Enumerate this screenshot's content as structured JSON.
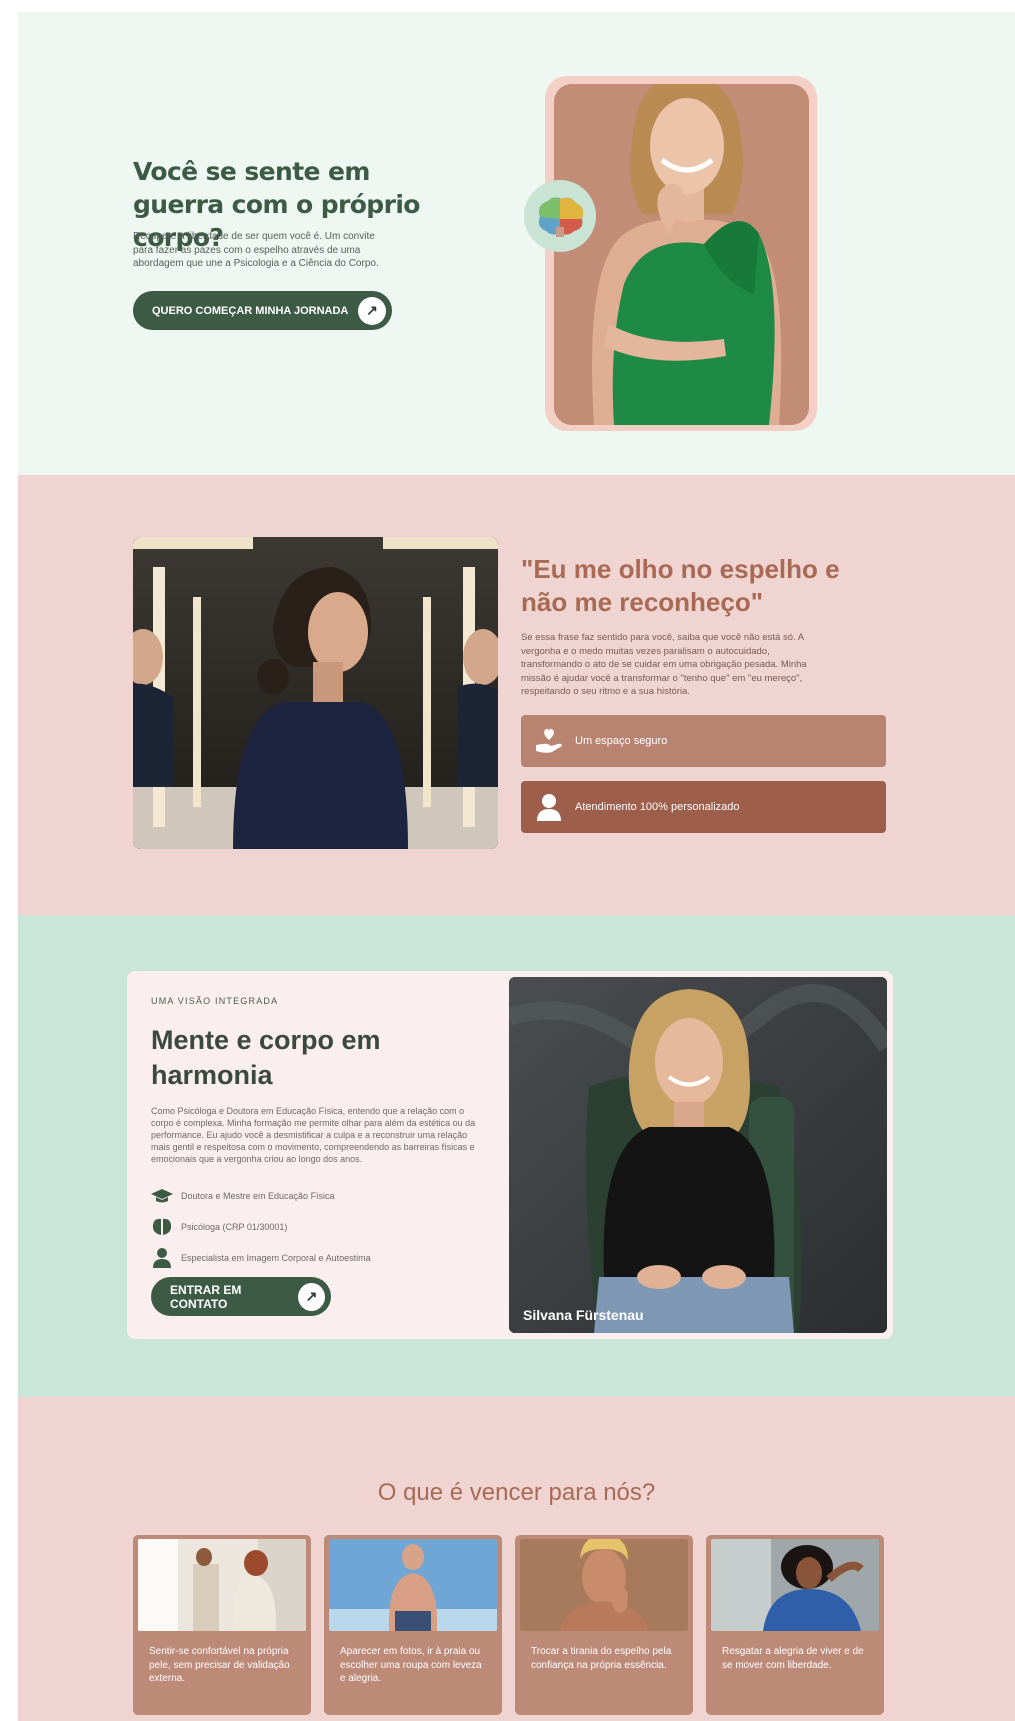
{
  "hero": {
    "title": "Você se sente em guerra com o próprio corpo?",
    "text": "Recupere a liberdade de ser quem você é. Um convite para fazer as pazes com o espelho através de uma abordagem que une a Psicologia e a Ciência do Corpo.",
    "cta_label": "QUERO COMEÇAR MINHA JORNADA",
    "cta_icon": "arrow-up-right-icon"
  },
  "mirror": {
    "quote": "\"Eu me olho no espelho e não me reconheço\"",
    "text": "Se essa frase faz sentido para você, saiba que você não está só. A vergonha e o medo muitas vezes paralisam o autocuidado, transformando o ato de se cuidar em uma obrigação pesada. Minha missão é ajudar você a transformar o \"tenho que\" em \"eu mereço\", respeitando o seu ritmo e a sua história.",
    "features": [
      {
        "label": "Um espaço seguro",
        "icon": "heart-hand-icon"
      },
      {
        "label": "Atendimento 100% personalizado",
        "icon": "user-icon"
      }
    ]
  },
  "integrated": {
    "eyebrow": "UMA VISÃO INTEGRADA",
    "title": "Mente e corpo em harmonia",
    "text": "Como Psicóloga e Doutora em Educação Física, entendo que a relação com o corpo é complexa. Minha formação me permite olhar para além da estética ou da performance. Eu ajudo você a desmistificar a culpa e a reconstruir uma relação mais gentil e respeitosa com o movimento, compreendendo as barreiras físicas e emocionais que a vergonha criou ao longo dos anos.",
    "credentials": [
      {
        "label": "Doutora e Mestre em Educação Física",
        "icon": "graduation-cap-icon"
      },
      {
        "label": "Psicóloga (CRP 01/30001)",
        "icon": "brain-icon"
      },
      {
        "label": "Especialista em Imagem Corporal e Autoestima",
        "icon": "user-icon"
      }
    ],
    "cta_label": "ENTRAR EM CONTATO",
    "photo_name": "Silvana Fürstenau"
  },
  "victory": {
    "title": "O que é vencer para nós?",
    "cards": [
      {
        "text": "Sentir-se confortável na própria pele, sem precisar de validação externa."
      },
      {
        "text": "Aparecer em fotos, ir à praia ou escolher uma roupa com leveza e alegria."
      },
      {
        "text": "Trocar a tirania do espelho pela confiança na própria essência."
      },
      {
        "text": "Resgatar a alegria de viver e de se mover com liberdade."
      }
    ]
  },
  "colors": {
    "primary_green": "#3d5a45",
    "hero_bg": "#eef7f2",
    "rose_bg": "#efd4d2",
    "mint_bg": "#cae6d9",
    "terracotta": "#a96a55"
  }
}
